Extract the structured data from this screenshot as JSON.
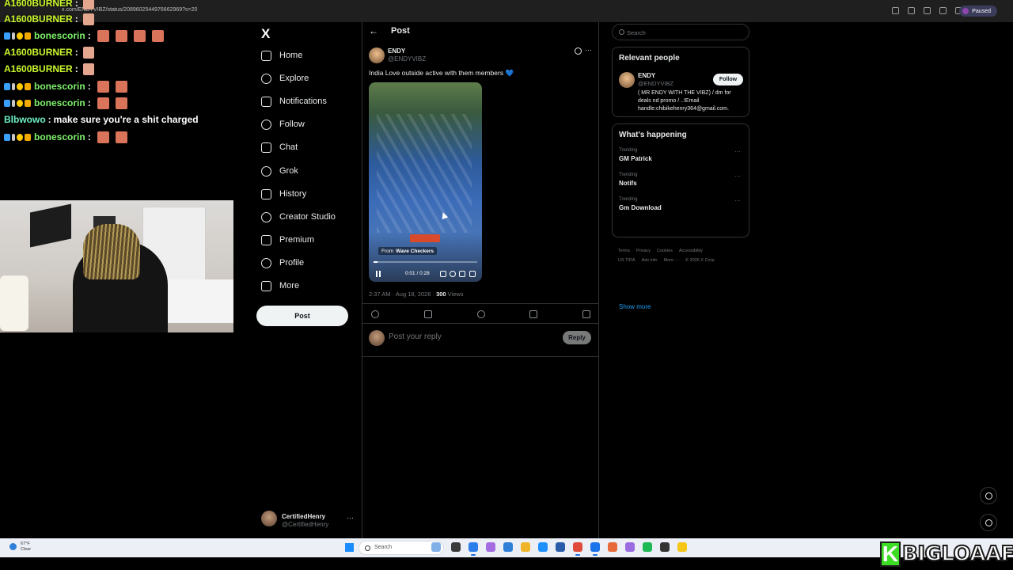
{
  "browser": {
    "url": "x.com/ENDYVIBZ/status/2089602544976662969?s=20",
    "profile_status": "Paused"
  },
  "chat": [
    {
      "user": "A1600BURNER",
      "message": "",
      "color": "yellow",
      "badges": false,
      "emotes": 1,
      "emote_type": "hand"
    },
    {
      "user": "A1600BURNER",
      "message": "",
      "color": "yellow",
      "badges": false,
      "emotes": 1,
      "emote_type": "hand"
    },
    {
      "user": "bonescorin",
      "message": "",
      "color": "green",
      "badges": true,
      "emotes": 4,
      "emote_type": "face"
    },
    {
      "user": "A1600BURNER",
      "message": "",
      "color": "yellow",
      "badges": false,
      "emotes": 1,
      "emote_type": "hand"
    },
    {
      "user": "A1600BURNER",
      "message": "",
      "color": "yellow",
      "badges": false,
      "emotes": 1,
      "emote_type": "hand"
    },
    {
      "user": "bonescorin",
      "message": "",
      "color": "green",
      "badges": true,
      "emotes": 2,
      "emote_type": "face"
    },
    {
      "user": "bonescorin",
      "message": "",
      "color": "green",
      "badges": true,
      "emotes": 2,
      "emote_type": "face"
    },
    {
      "user": "Blbwowo",
      "message": "make sure you're a shit charged",
      "color": "cyan",
      "badges": false,
      "emotes": 0,
      "emote_type": ""
    },
    {
      "user": "bonescorin",
      "message": "",
      "color": "green",
      "badges": true,
      "emotes": 2,
      "emote_type": "face"
    }
  ],
  "nav": {
    "logo": "X",
    "items": [
      {
        "label": "Home",
        "icon": "home-icon"
      },
      {
        "label": "Explore",
        "icon": "search-icon"
      },
      {
        "label": "Notifications",
        "icon": "bell-icon"
      },
      {
        "label": "Follow",
        "icon": "person-icon"
      },
      {
        "label": "Chat",
        "icon": "chat-icon"
      },
      {
        "label": "Grok",
        "icon": "grok-icon"
      },
      {
        "label": "History",
        "icon": "bookmark-icon"
      },
      {
        "label": "Creator Studio",
        "icon": "rocket-icon"
      },
      {
        "label": "Premium",
        "icon": "premium-icon"
      },
      {
        "label": "Profile",
        "icon": "profile-icon"
      },
      {
        "label": "More",
        "icon": "more-icon"
      }
    ],
    "post_label": "Post"
  },
  "account": {
    "name": "CertifiedHenry",
    "handle": "@CertifiedHenry",
    "more": "···"
  },
  "post": {
    "header": "Post",
    "author_name": "ENDY",
    "author_handle": "@ENDYVIBZ",
    "more": "···",
    "text": "India Love outside active with them members",
    "emoji": "💙",
    "video": {
      "source_prefix": "From",
      "source_name": "Wave Checkers",
      "time": "0:01 / 0:28",
      "progress": 0.04
    },
    "time_date": "2:37 AM · Aug 18, 2026 · ",
    "views_count": "300",
    "views_label": " Views",
    "reply_placeholder": "Post your reply",
    "reply_button": "Reply"
  },
  "right": {
    "search_placeholder": "Search",
    "relevant_title": "Relevant people",
    "person": {
      "name": "ENDY",
      "handle": "@ENDYVIBZ",
      "follow_label": "Follow",
      "bio": "( MR ENDY WITH THE VIBZ) / dm for deals nd promo / ..!Email handle:chibikehenry364@gmail.com."
    },
    "happening_title": "What's happening",
    "trends": [
      {
        "label": "Trending",
        "name": "GM Patrick"
      },
      {
        "label": "Trending",
        "name": "Notifs"
      },
      {
        "label": "Trending",
        "name": "Gm Download"
      }
    ],
    "show_more": "Show more",
    "footer": [
      "Terms",
      "Privacy",
      "Cookies",
      "Accessibility",
      "US TIDA",
      "Ads info",
      "More ···",
      "© 2026 X Corp."
    ]
  },
  "taskbar": {
    "weather_temp": "67°F",
    "weather_desc": "Clear",
    "search_label": "Search"
  },
  "watermark": {
    "k": "K",
    "text": "BIGLOAAF"
  }
}
